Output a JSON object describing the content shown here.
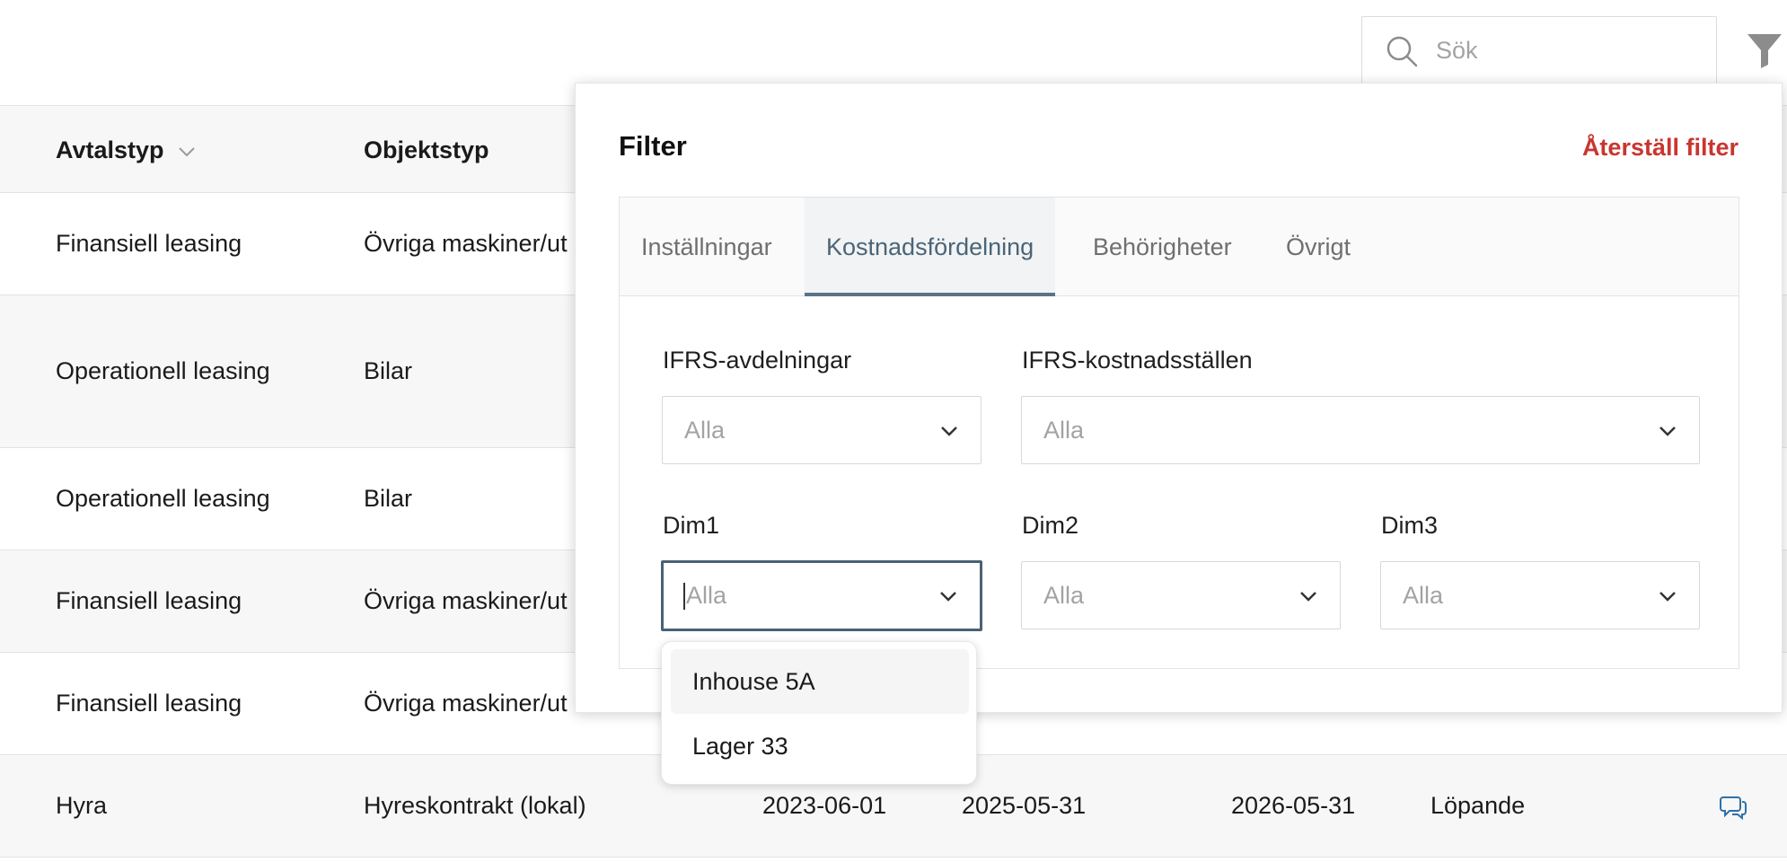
{
  "search": {
    "placeholder": "Sök"
  },
  "table": {
    "headers": [
      "Avtalstyp",
      "Objektstyp"
    ],
    "rows": [
      {
        "avtalstyp": "Finansiell leasing",
        "objektstyp": "Övriga maskiner/ut"
      },
      {
        "avtalstyp": "Operationell leasing",
        "objektstyp": "Bilar"
      },
      {
        "avtalstyp": "Operationell leasing",
        "objektstyp": "Bilar"
      },
      {
        "avtalstyp": "Finansiell leasing",
        "objektstyp": "Övriga maskiner/ut"
      },
      {
        "avtalstyp": "Finansiell leasing",
        "objektstyp": "Övriga maskiner/ut"
      },
      {
        "avtalstyp": "Hyra",
        "objektstyp": "Hyreskontrakt (lokal)",
        "date1": "2023-06-01",
        "date2": "2025-05-31",
        "date3": "2026-05-31",
        "status": "Löpande"
      }
    ]
  },
  "filter": {
    "title": "Filter",
    "reset_label": "Återställ filter",
    "tabs": [
      "Inställningar",
      "Kostnadsfördelning",
      "Behörigheter",
      "Övrigt"
    ],
    "active_tab": "Kostnadsfördelning",
    "fields": {
      "ifrs_avdelningar": {
        "label": "IFRS-avdelningar",
        "placeholder": "Alla"
      },
      "ifrs_kostnadsstallen": {
        "label": "IFRS-kostnadsställen",
        "placeholder": "Alla"
      },
      "dim1": {
        "label": "Dim1",
        "placeholder": "Alla"
      },
      "dim2": {
        "label": "Dim2",
        "placeholder": "Alla"
      },
      "dim3": {
        "label": "Dim3",
        "placeholder": "Alla"
      }
    },
    "dim1_options": [
      "Inhouse 5A",
      "Lager 33"
    ]
  },
  "colors": {
    "accent": "#4a6174",
    "reset": "#c8362f",
    "comment_icon": "#2f6fa8"
  },
  "icons": {
    "search": "search-icon",
    "filter": "filter-funnel-icon",
    "sort": "chevron-down-icon",
    "comment": "comment-icon"
  }
}
